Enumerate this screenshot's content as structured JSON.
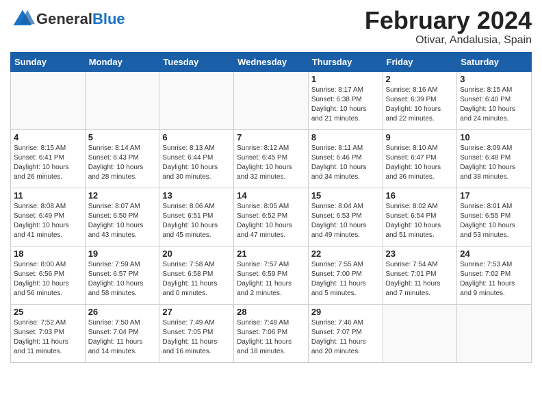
{
  "header": {
    "logo_general": "General",
    "logo_blue": "Blue",
    "month_title": "February 2024",
    "location": "Otivar, Andalusia, Spain"
  },
  "weekdays": [
    "Sunday",
    "Monday",
    "Tuesday",
    "Wednesday",
    "Thursday",
    "Friday",
    "Saturday"
  ],
  "weeks": [
    [
      {
        "day": "",
        "info": ""
      },
      {
        "day": "",
        "info": ""
      },
      {
        "day": "",
        "info": ""
      },
      {
        "day": "",
        "info": ""
      },
      {
        "day": "1",
        "info": "Sunrise: 8:17 AM\nSunset: 6:38 PM\nDaylight: 10 hours\nand 21 minutes."
      },
      {
        "day": "2",
        "info": "Sunrise: 8:16 AM\nSunset: 6:39 PM\nDaylight: 10 hours\nand 22 minutes."
      },
      {
        "day": "3",
        "info": "Sunrise: 8:15 AM\nSunset: 6:40 PM\nDaylight: 10 hours\nand 24 minutes."
      }
    ],
    [
      {
        "day": "4",
        "info": "Sunrise: 8:15 AM\nSunset: 6:41 PM\nDaylight: 10 hours\nand 26 minutes."
      },
      {
        "day": "5",
        "info": "Sunrise: 8:14 AM\nSunset: 6:43 PM\nDaylight: 10 hours\nand 28 minutes."
      },
      {
        "day": "6",
        "info": "Sunrise: 8:13 AM\nSunset: 6:44 PM\nDaylight: 10 hours\nand 30 minutes."
      },
      {
        "day": "7",
        "info": "Sunrise: 8:12 AM\nSunset: 6:45 PM\nDaylight: 10 hours\nand 32 minutes."
      },
      {
        "day": "8",
        "info": "Sunrise: 8:11 AM\nSunset: 6:46 PM\nDaylight: 10 hours\nand 34 minutes."
      },
      {
        "day": "9",
        "info": "Sunrise: 8:10 AM\nSunset: 6:47 PM\nDaylight: 10 hours\nand 36 minutes."
      },
      {
        "day": "10",
        "info": "Sunrise: 8:09 AM\nSunset: 6:48 PM\nDaylight: 10 hours\nand 38 minutes."
      }
    ],
    [
      {
        "day": "11",
        "info": "Sunrise: 8:08 AM\nSunset: 6:49 PM\nDaylight: 10 hours\nand 41 minutes."
      },
      {
        "day": "12",
        "info": "Sunrise: 8:07 AM\nSunset: 6:50 PM\nDaylight: 10 hours\nand 43 minutes."
      },
      {
        "day": "13",
        "info": "Sunrise: 8:06 AM\nSunset: 6:51 PM\nDaylight: 10 hours\nand 45 minutes."
      },
      {
        "day": "14",
        "info": "Sunrise: 8:05 AM\nSunset: 6:52 PM\nDaylight: 10 hours\nand 47 minutes."
      },
      {
        "day": "15",
        "info": "Sunrise: 8:04 AM\nSunset: 6:53 PM\nDaylight: 10 hours\nand 49 minutes."
      },
      {
        "day": "16",
        "info": "Sunrise: 8:02 AM\nSunset: 6:54 PM\nDaylight: 10 hours\nand 51 minutes."
      },
      {
        "day": "17",
        "info": "Sunrise: 8:01 AM\nSunset: 6:55 PM\nDaylight: 10 hours\nand 53 minutes."
      }
    ],
    [
      {
        "day": "18",
        "info": "Sunrise: 8:00 AM\nSunset: 6:56 PM\nDaylight: 10 hours\nand 56 minutes."
      },
      {
        "day": "19",
        "info": "Sunrise: 7:59 AM\nSunset: 6:57 PM\nDaylight: 10 hours\nand 58 minutes."
      },
      {
        "day": "20",
        "info": "Sunrise: 7:58 AM\nSunset: 6:58 PM\nDaylight: 11 hours\nand 0 minutes."
      },
      {
        "day": "21",
        "info": "Sunrise: 7:57 AM\nSunset: 6:59 PM\nDaylight: 11 hours\nand 2 minutes."
      },
      {
        "day": "22",
        "info": "Sunrise: 7:55 AM\nSunset: 7:00 PM\nDaylight: 11 hours\nand 5 minutes."
      },
      {
        "day": "23",
        "info": "Sunrise: 7:54 AM\nSunset: 7:01 PM\nDaylight: 11 hours\nand 7 minutes."
      },
      {
        "day": "24",
        "info": "Sunrise: 7:53 AM\nSunset: 7:02 PM\nDaylight: 11 hours\nand 9 minutes."
      }
    ],
    [
      {
        "day": "25",
        "info": "Sunrise: 7:52 AM\nSunset: 7:03 PM\nDaylight: 11 hours\nand 11 minutes."
      },
      {
        "day": "26",
        "info": "Sunrise: 7:50 AM\nSunset: 7:04 PM\nDaylight: 11 hours\nand 14 minutes."
      },
      {
        "day": "27",
        "info": "Sunrise: 7:49 AM\nSunset: 7:05 PM\nDaylight: 11 hours\nand 16 minutes."
      },
      {
        "day": "28",
        "info": "Sunrise: 7:48 AM\nSunset: 7:06 PM\nDaylight: 11 hours\nand 18 minutes."
      },
      {
        "day": "29",
        "info": "Sunrise: 7:46 AM\nSunset: 7:07 PM\nDaylight: 11 hours\nand 20 minutes."
      },
      {
        "day": "",
        "info": ""
      },
      {
        "day": "",
        "info": ""
      }
    ]
  ]
}
